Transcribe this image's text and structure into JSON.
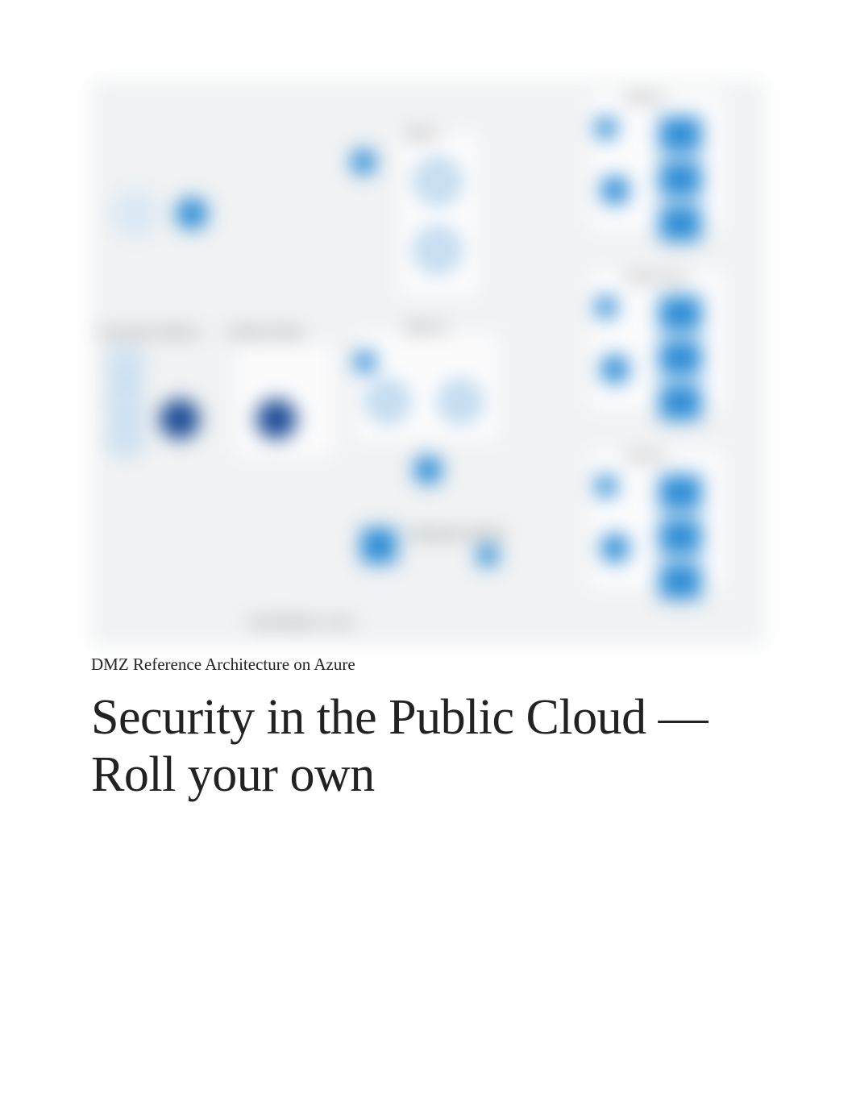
{
  "caption": "DMZ Reference Architecture on Azure",
  "title": "Security in the Public Cloud — Roll your own",
  "diagram_labels": {
    "on_prem": "On-premises Network",
    "gateway": "Gateway Subnet",
    "dmz_in": "DMZ in",
    "dmz_out": "DMZ out",
    "mgmt": "Management Subnet",
    "web1": "Web tier",
    "web2": "Business tier",
    "web3": "Data tier",
    "vnet": "Virtual Network - Azure"
  }
}
